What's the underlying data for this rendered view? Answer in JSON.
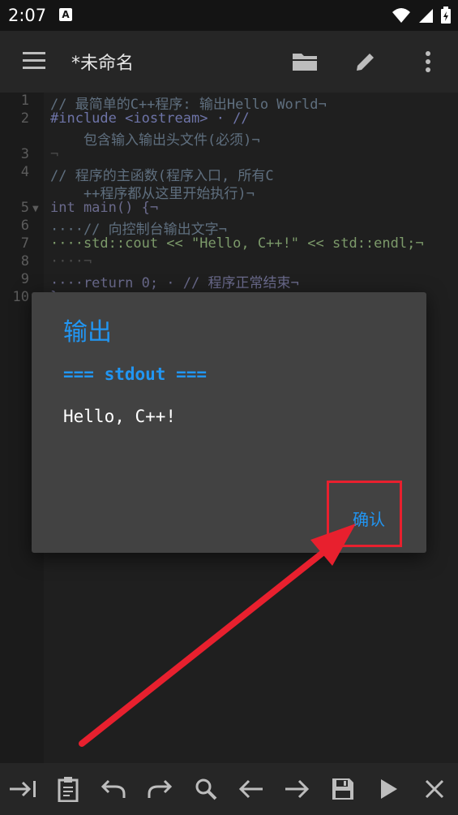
{
  "status_bar": {
    "time": "2:07",
    "notification_icon": "A"
  },
  "app_bar": {
    "title": "*未命名",
    "icons": [
      "menu-icon",
      "folder-icon",
      "edit-icon",
      "more-vert-icon"
    ]
  },
  "editor": {
    "line_numbers": [
      "1",
      "2",
      "3",
      "4",
      "5",
      "6",
      "7",
      "8",
      "9",
      "10"
    ],
    "lines": [
      "// 最简单的C++程序: 输出Hello World¬",
      "#include <iostream> · //",
      "    包含输入输出头文件(必须)¬",
      "¬",
      "// 程序的主函数(程序入口, 所有C",
      "    ++程序都从这里开始执行)¬",
      "int main() {¬",
      "····// 向控制台输出文字¬",
      "····std::cout << \"Hello, C++!\" << std::endl;¬",
      "····¬",
      "····return 0; · // 程序正常结束¬",
      "}"
    ]
  },
  "dialog": {
    "title": "输出",
    "stdout_header": "=== stdout ===",
    "output": "Hello, C++!",
    "confirm_label": "确认"
  },
  "toolbar": {
    "icons": [
      "tab-icon",
      "clipboard-icon",
      "undo-icon",
      "redo-icon",
      "search-icon",
      "arrow-left-icon",
      "arrow-right-icon",
      "save-icon",
      "run-icon",
      "close-icon"
    ]
  },
  "colors": {
    "accent": "#2196f3",
    "annotation": "#e8202e",
    "background": "#1f1f1f",
    "dialog": "#424242"
  }
}
